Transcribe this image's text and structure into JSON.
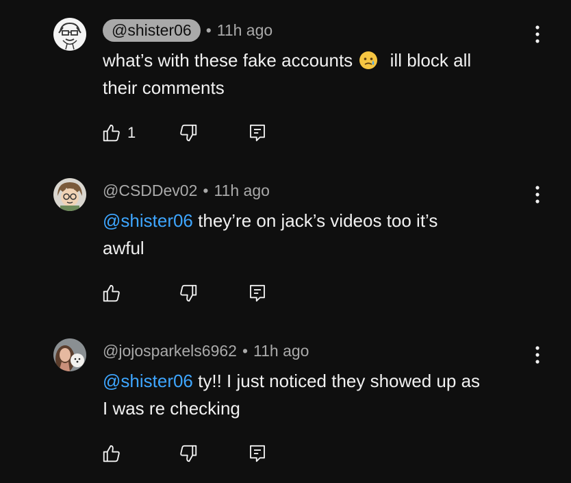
{
  "comments": [
    {
      "handle": "@shister06",
      "handle_highlighted": true,
      "separator": "•",
      "time": "11h ago",
      "mention": "",
      "text_line1": "what’s with these fake accounts",
      "emoji_icon": "sad-tear-emoji-icon",
      "text_rest": "ill block all",
      "text_line2": "their comments",
      "like_count": "1"
    },
    {
      "handle": "@CSDDev02",
      "handle_highlighted": false,
      "separator": "•",
      "time": "11h ago",
      "mention": "@shister06",
      "text_line1": " they’re on jack’s videos too it’s",
      "text_line2": "awful",
      "like_count": ""
    },
    {
      "handle": "@jojosparkels6962",
      "handle_highlighted": false,
      "separator": "•",
      "time": "11h ago",
      "mention": "@shister06",
      "text_line1": " ty!! I just noticed they showed up as",
      "text_line2": "I was re checking",
      "like_count": ""
    }
  ],
  "colors": {
    "background": "#0f0f0f",
    "text": "#f1f1f1",
    "secondary_text": "#aaaaaa",
    "mention": "#3ea6ff",
    "pill_bg": "#a9a9a9"
  }
}
